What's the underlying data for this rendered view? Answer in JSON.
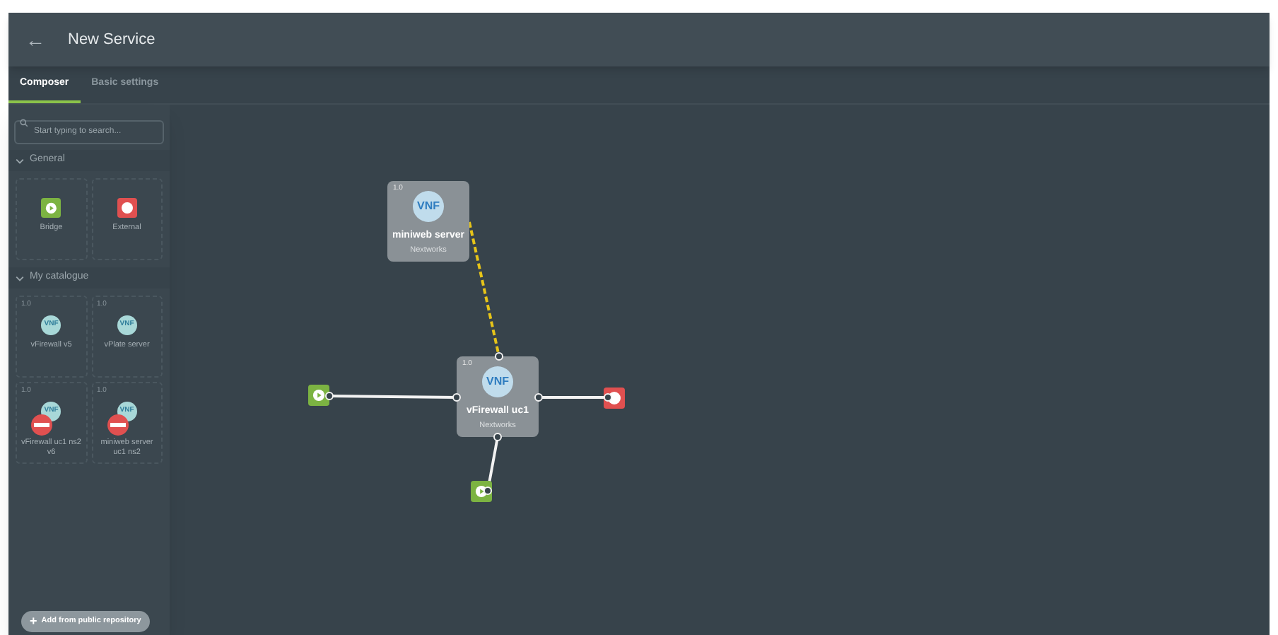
{
  "header": {
    "back_icon": "←",
    "title": "New Service"
  },
  "tabs": [
    {
      "label": "Composer",
      "selected": true
    },
    {
      "label": "Basic settings",
      "selected": false
    }
  ],
  "search": {
    "placeholder": "Start typing to search..."
  },
  "sections": [
    {
      "title": "General",
      "expanded": true,
      "items": [
        {
          "kind": "bridge",
          "label": "Bridge"
        },
        {
          "kind": "external",
          "label": "External"
        }
      ]
    },
    {
      "title": "My catalogue",
      "expanded": true,
      "items": [
        {
          "kind": "vnf",
          "version": "1.0",
          "badge": "VNF",
          "label": "vFirewall v5",
          "disabled": false
        },
        {
          "kind": "vnf",
          "version": "1.0",
          "badge": "VNF",
          "label": "vPlate server",
          "disabled": false
        },
        {
          "kind": "vnf",
          "version": "1.0",
          "badge": "VNF",
          "label": "vFirewall uc1 ns2 v6",
          "disabled": true
        },
        {
          "kind": "vnf",
          "version": "1.0",
          "badge": "VNF",
          "label": "miniweb server uc1 ns2",
          "disabled": true
        }
      ]
    }
  ],
  "add_button": {
    "icon": "+",
    "label": "Add from public repository"
  },
  "canvas": {
    "nodes": [
      {
        "kind": "vnf",
        "version": "1.0",
        "badge": "VNF",
        "name": "miniweb server",
        "vendor": "Nextworks"
      },
      {
        "kind": "vnf",
        "version": "1.0",
        "badge": "VNF",
        "name": "vFirewall uc1",
        "vendor": "Nextworks"
      },
      {
        "kind": "bridge"
      },
      {
        "kind": "external"
      },
      {
        "kind": "bridge"
      }
    ],
    "links": [
      {
        "kind": "dashed"
      },
      {
        "kind": "solid"
      },
      {
        "kind": "solid"
      },
      {
        "kind": "solid"
      }
    ]
  }
}
